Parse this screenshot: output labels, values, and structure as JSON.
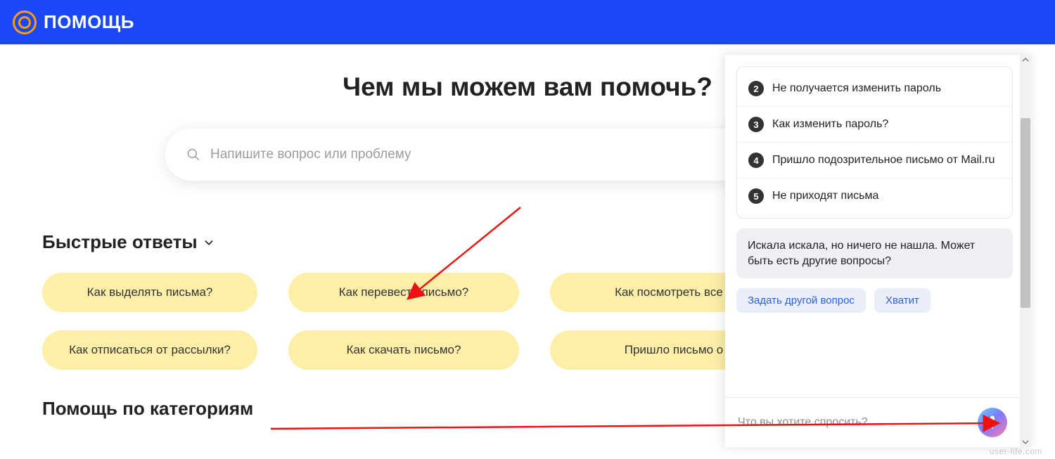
{
  "header": {
    "brand": "ПОМОЩЬ"
  },
  "hero": {
    "title": "Чем мы можем вам помочь?"
  },
  "search": {
    "placeholder": "Напишите вопрос или проблему"
  },
  "quick": {
    "heading": "Быстрые ответы",
    "row1": [
      "Как выделять письма?",
      "Как перевести письмо?",
      "Как посмотреть все н"
    ],
    "row2": [
      "Как отписаться от рассылки?",
      "Как скачать письмо?",
      "Пришло письмо о"
    ]
  },
  "categories": {
    "heading": "Помощь по категориям"
  },
  "chat": {
    "faq": [
      {
        "n": "2",
        "text": "Не получается изменить пароль"
      },
      {
        "n": "3",
        "text": "Как изменить пароль?"
      },
      {
        "n": "4",
        "text": "Пришло подозрительное письмо от Mail.ru"
      },
      {
        "n": "5",
        "text": "Не приходят письма"
      }
    ],
    "bot_message": "Искала искала, но ничего не нашла. Может быть есть другие вопросы?",
    "chips": [
      "Задать другой вопрос",
      "Хватит"
    ],
    "input_placeholder": "Что вы хотите спросить?"
  },
  "watermark": "user-life.com"
}
